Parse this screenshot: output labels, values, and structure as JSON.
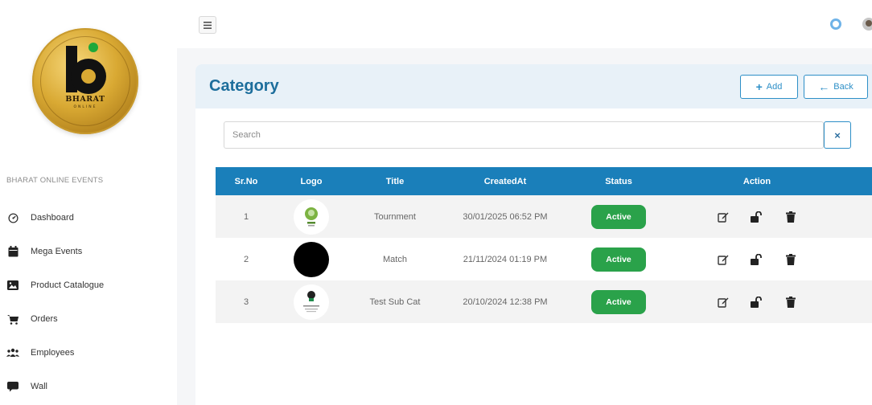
{
  "sidebar": {
    "heading": "BHARAT ONLINE EVENTS",
    "logo_text": "BHARAT",
    "logo_subtext": "ONLINE",
    "items": [
      {
        "label": "Dashboard",
        "icon": "dashboard-icon"
      },
      {
        "label": "Mega Events",
        "icon": "calendar-icon"
      },
      {
        "label": "Product Catalogue",
        "icon": "image-icon"
      },
      {
        "label": "Orders",
        "icon": "cart-icon"
      },
      {
        "label": "Employees",
        "icon": "users-icon"
      },
      {
        "label": "Wall",
        "icon": "comment-icon"
      }
    ]
  },
  "page": {
    "title": "Category",
    "add_label": "Add",
    "back_label": "Back",
    "search_placeholder": "Search",
    "clear_label": "×"
  },
  "table": {
    "headers": {
      "sr": "Sr.No",
      "logo": "Logo",
      "title": "Title",
      "created": "CreatedAt",
      "status": "Status",
      "action": "Action"
    },
    "rows": [
      {
        "sr": "1",
        "title": "Tournment",
        "created": "30/01/2025 06:52 PM",
        "status": "Active"
      },
      {
        "sr": "2",
        "title": "Match",
        "created": "21/11/2024 01:19 PM",
        "status": "Active"
      },
      {
        "sr": "3",
        "title": "Test Sub Cat",
        "created": "20/10/2024 12:38 PM",
        "status": "Active"
      }
    ]
  },
  "colors": {
    "primary": "#1a7fba",
    "title": "#1d6e9c",
    "active": "#2aa24a",
    "header_bg": "#e8f1f8"
  }
}
